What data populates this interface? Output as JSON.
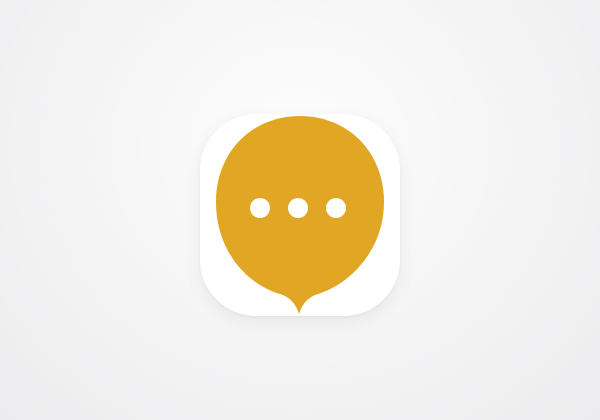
{
  "screen": {
    "background_top": "#fdfdfd",
    "background_bottom": "#ececee"
  },
  "app_icon": {
    "icon": "chat-bubble-ellipsis-icon",
    "tile_color": "#ffffff",
    "bubble_color": "#e0a624",
    "dot_color": "#ffffff"
  }
}
